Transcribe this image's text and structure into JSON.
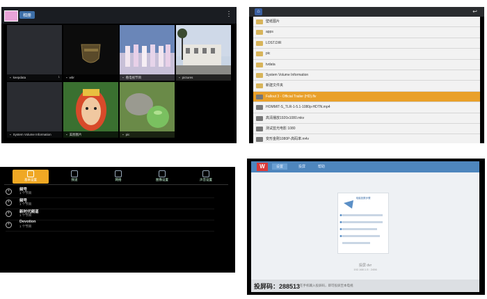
{
  "gallery": {
    "tag": "相册",
    "tiles": [
      {
        "name": "keepdata",
        "count": "1"
      },
      {
        "name": "wbr",
        "count": ""
      },
      {
        "name": "看电视节目",
        "count": ""
      },
      {
        "name": "pictures",
        "count": ""
      },
      {
        "name": "System Volume Information",
        "count": ""
      },
      {
        "name": "美图图片",
        "count": ""
      },
      {
        "name": "pic",
        "count": ""
      }
    ]
  },
  "files": {
    "rows": [
      {
        "name": "壁纸图片",
        "type": "folder"
      },
      {
        "name": "apps",
        "type": "folder"
      },
      {
        "name": "LOST.DIR",
        "type": "folder"
      },
      {
        "name": "pic",
        "type": "folder"
      },
      {
        "name": "tvdata",
        "type": "folder"
      },
      {
        "name": "System Volume Information",
        "type": "folder"
      },
      {
        "name": "新建文件夹",
        "type": "folder"
      },
      {
        "name": "Fallout 3 - Official Trailer (HD).flv",
        "type": "file",
        "selected": true
      },
      {
        "name": "HOMMIT-S_TLR-1-5.1-1080p-HDTN.mp4",
        "type": "file"
      },
      {
        "name": "高清播放1920x1080.mkv",
        "type": "file"
      },
      {
        "name": "测试蓝光电影 1080",
        "type": "file"
      },
      {
        "name": "变形金刚1080P-高码率.m4v",
        "type": "file"
      }
    ]
  },
  "settings": {
    "tabs": [
      "基本设置",
      "频道",
      "网络",
      "图像设置",
      "声音设置"
    ],
    "items": [
      {
        "title": "频号",
        "sub": "1 个节目"
      },
      {
        "title": "频号",
        "sub": "1 个节目"
      },
      {
        "title": "新时代频道",
        "sub": "1 个节目"
      },
      {
        "title": "Devotion",
        "sub": "1 个节目"
      }
    ]
  },
  "mirror": {
    "logo": "W",
    "tabs": [
      "设置",
      "投屏",
      "帮助"
    ],
    "card_title": "电脑投屏步骤",
    "device_name": "投屏 dvr",
    "device_ip": "192.168.1.5 : 2456",
    "code_label": "投屏码：288513",
    "hint": "在手机输入投屏码，即可投屏至本电视",
    "colors": {
      "accent": "#4e86bd",
      "logo": "#d93a3a"
    }
  }
}
